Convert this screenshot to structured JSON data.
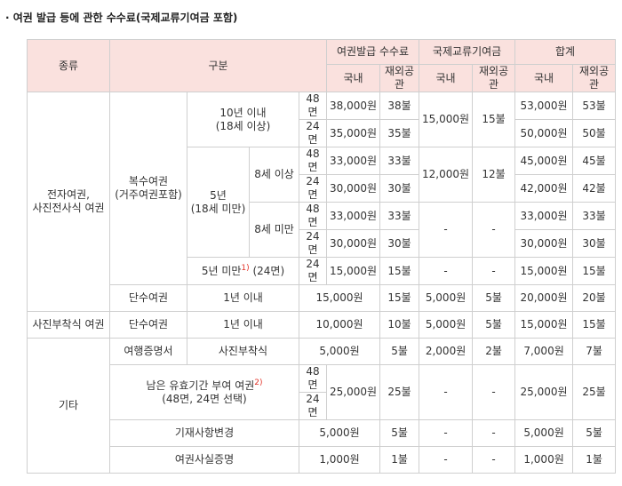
{
  "page_title": "· 여권 발급 등에 관한 수수료(국제교류기여금 포함)",
  "header": {
    "kind": "종류",
    "category": "구분",
    "issue_fee": "여권발급 수수료",
    "intl_fund": "국제교류기여금",
    "total": "합계",
    "domestic": "국내",
    "overseas": "재외공관"
  },
  "groups": {
    "electronic": "전자여권,\n사진전사식 여권",
    "photo_attached": "사진부착식 여권",
    "other": "기타"
  },
  "labels": {
    "multiple": "복수여권\n(거주여권포함)",
    "ten_year": "10년 이내\n(18세 이상)",
    "five_year": "5년\n(18세 미만)",
    "age8_over": "8세 이상",
    "age8_under": "8세 미만",
    "under5_prefix": "5년 미만",
    "under5_note": "1)",
    "under5_suffix": "(24면)",
    "single": "단수여권",
    "within_1y": "1년 이내",
    "travel_cert": "여행증명서",
    "photo_attach": "사진부착식",
    "remaining_prefix": "남은 유효기간 부여 여권",
    "remaining_note": "2)",
    "remaining_suffix": "(48면, 24면 선택)",
    "record_change": "기재사항변경",
    "fact_cert": "여권사실증명"
  },
  "rows": {
    "r1": {
      "pages": "48면",
      "fee_dom": "38,000원",
      "fee_ovs": "38불",
      "fund_dom": "15,000원",
      "fund_ovs": "15불",
      "tot_dom": "53,000원",
      "tot_ovs": "53불"
    },
    "r2": {
      "pages": "24면",
      "fee_dom": "35,000원",
      "fee_ovs": "35불",
      "tot_dom": "50,000원",
      "tot_ovs": "50불"
    },
    "r3": {
      "pages": "48면",
      "fee_dom": "33,000원",
      "fee_ovs": "33불",
      "fund_dom": "12,000원",
      "fund_ovs": "12불",
      "tot_dom": "45,000원",
      "tot_ovs": "45불"
    },
    "r4": {
      "pages": "24면",
      "fee_dom": "30,000원",
      "fee_ovs": "30불",
      "tot_dom": "42,000원",
      "tot_ovs": "42불"
    },
    "r5": {
      "pages": "48면",
      "fee_dom": "33,000원",
      "fee_ovs": "33불",
      "fund_dom": "-",
      "fund_ovs": "-",
      "tot_dom": "33,000원",
      "tot_ovs": "33불"
    },
    "r6": {
      "pages": "24면",
      "fee_dom": "30,000원",
      "fee_ovs": "30불",
      "tot_dom": "30,000원",
      "tot_ovs": "30불"
    },
    "r7": {
      "pages": "24면",
      "fee_dom": "15,000원",
      "fee_ovs": "15불",
      "fund_dom": "-",
      "fund_ovs": "-",
      "tot_dom": "15,000원",
      "tot_ovs": "15불"
    },
    "r8": {
      "fee": "15,000원",
      "fee_ovs": "15불",
      "fund_dom": "5,000원",
      "fund_ovs": "5불",
      "tot_dom": "20,000원",
      "tot_ovs": "20불"
    },
    "r9": {
      "fee": "10,000원",
      "fee_ovs": "10불",
      "fund_dom": "5,000원",
      "fund_ovs": "5불",
      "tot_dom": "15,000원",
      "tot_ovs": "15불"
    },
    "r10": {
      "fee": "5,000원",
      "fee_ovs": "5불",
      "fund_dom": "2,000원",
      "fund_ovs": "2불",
      "tot_dom": "7,000원",
      "tot_ovs": "7불"
    },
    "r11": {
      "pages_a": "48면",
      "pages_b": "24면",
      "fee": "25,000원",
      "fee_ovs": "25불",
      "fund_dom": "-",
      "fund_ovs": "-",
      "tot_dom": "25,000원",
      "tot_ovs": "25불"
    },
    "r12": {
      "fee": "5,000원",
      "fee_ovs": "5불",
      "fund_dom": "-",
      "fund_ovs": "-",
      "tot_dom": "5,000원",
      "tot_ovs": "5불"
    },
    "r13": {
      "fee": "1,000원",
      "fee_ovs": "1불",
      "fund_dom": "-",
      "fund_ovs": "-",
      "tot_dom": "1,000원",
      "tot_ovs": "1불"
    }
  },
  "colors": {
    "header_bg": "#fae1de",
    "border": "#cfcfcf",
    "note": "#e2342a"
  }
}
